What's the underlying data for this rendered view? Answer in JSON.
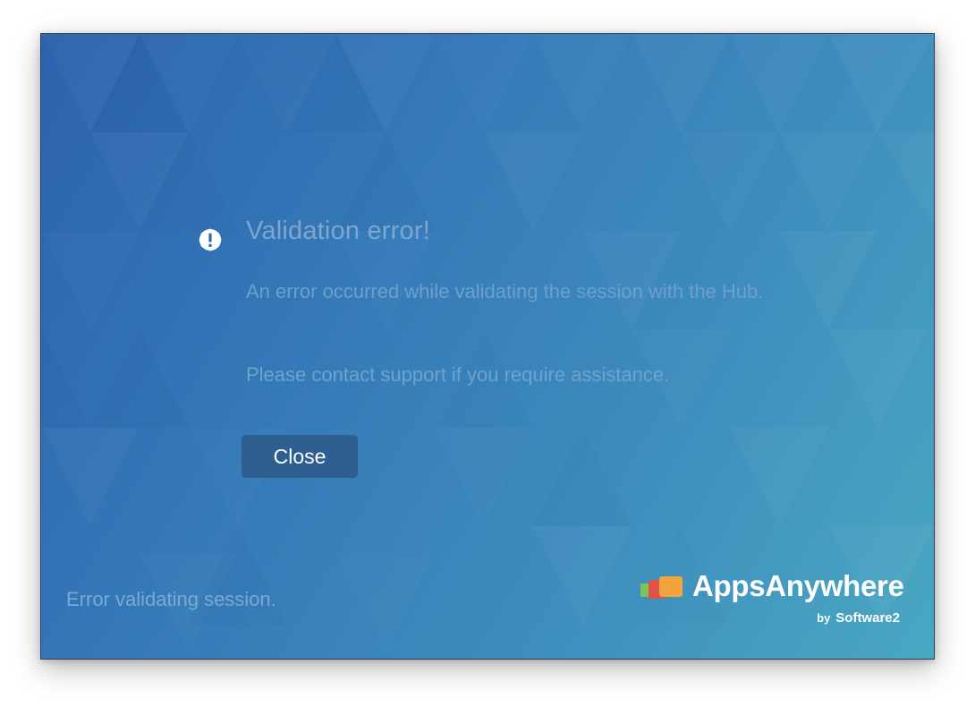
{
  "dialog": {
    "title": "Validation error!",
    "message": "An error occurred while validating the session with the Hub.",
    "support_text": "Please contact support if you require assistance.",
    "close_label": "Close",
    "icon": "exclamation-circle-icon"
  },
  "footer": {
    "status_text": "Error validating session."
  },
  "brand": {
    "name": "AppsAnywhere",
    "by_label": "by",
    "company": "Software2"
  },
  "colors": {
    "gradient_start": "#2c62ad",
    "gradient_end": "#49a8c2",
    "button_bg": "#2d5f91",
    "text_muted": "#7ea6d0",
    "logo_green": "#7dc25a",
    "logo_red": "#e0514a",
    "logo_orange": "#f2a53a"
  }
}
